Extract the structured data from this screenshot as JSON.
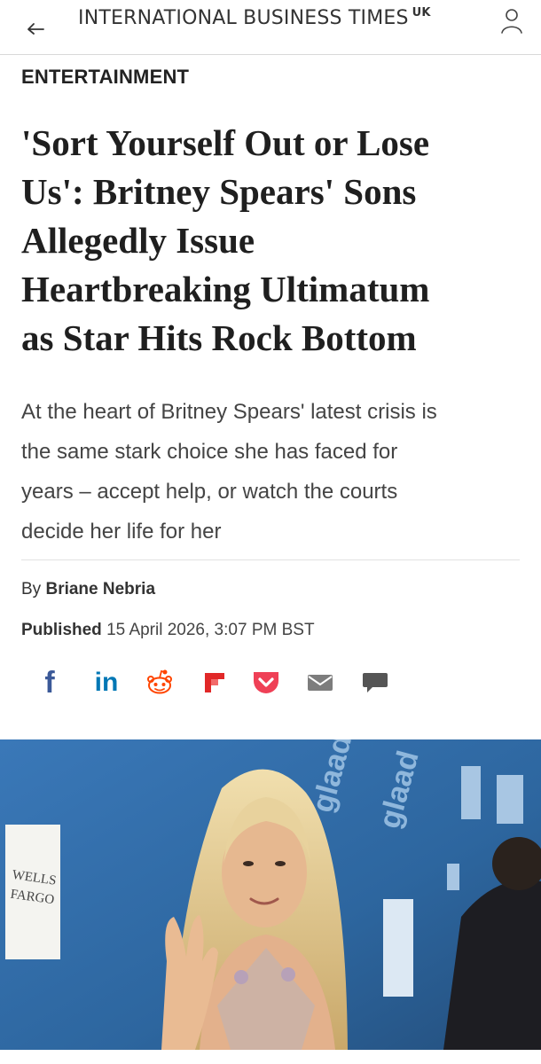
{
  "header": {
    "brand": "INTERNATIONAL BUSINESS TIMES",
    "edition": "UK",
    "icons": {
      "back": "back-arrow-icon",
      "user": "user-icon"
    }
  },
  "article": {
    "section": "ENTERTAINMENT",
    "headline_lines": [
      "'Sort Yourself Out or Lose",
      "Us': Britney Spears' Sons",
      "Allegedly Issue",
      "Heartbreaking Ultimatum",
      "as Star Hits Rock Bottom"
    ],
    "standfirst_lines": [
      "At the heart of Britney Spears' latest crisis is",
      "the same stark choice she has faced for",
      "years – accept help, or watch the courts",
      "decide her life for her"
    ],
    "byline_prefix": "By",
    "author": "Briane Nebria",
    "published_label": "Published",
    "published_date": "15 April 2026, 3:07 PM BST"
  },
  "share": {
    "facebook": "f",
    "linkedin": "in",
    "icons": [
      "facebook-icon",
      "linkedin-icon",
      "reddit-icon",
      "flipboard-icon",
      "pocket-icon",
      "email-icon",
      "comment-icon"
    ],
    "colors": {
      "facebook": "#3b5998",
      "linkedin": "#0077b5",
      "reddit": "#ff4500",
      "flipboard": "#e12828",
      "pocket": "#ef4056",
      "email": "#7d7d7d",
      "comment": "#555555"
    }
  },
  "hero_image": {
    "backdrop_text": [
      "WELLS",
      "FARGO",
      "glaad",
      "glaad"
    ],
    "backdrop_color": "#2f6aa6"
  }
}
